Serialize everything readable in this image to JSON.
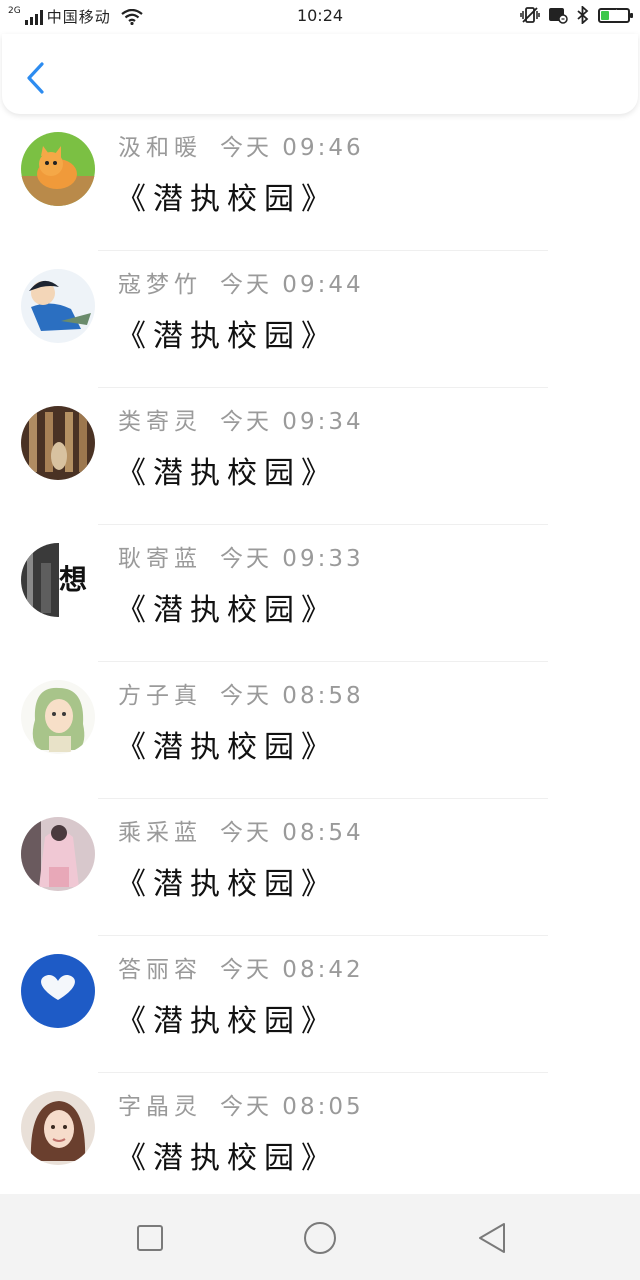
{
  "status_bar": {
    "network_gen": "2G",
    "carrier": "中国移动",
    "time": "10:24",
    "battery_color": "#3cc84a",
    "battery_level": 0.3,
    "icons": [
      "signal-icon",
      "wifi-icon",
      "vibrate-icon",
      "nfc-icon",
      "bluetooth-icon",
      "battery-icon"
    ]
  },
  "header": {
    "back_icon": "chevron-left-icon",
    "accent": "#2d8cf0"
  },
  "messages": [
    {
      "name": "汲和暖",
      "time": "今天 09:46",
      "title": "《潜执校园》",
      "avatar": "kitten"
    },
    {
      "name": "寇梦竹",
      "time": "今天 09:44",
      "title": "《潜执校园》",
      "avatar": "anime-boy"
    },
    {
      "name": "类寄灵",
      "time": "今天 09:34",
      "title": "《潜执校园》",
      "avatar": "sepia-hall"
    },
    {
      "name": "耿寄蓝",
      "time": "今天 09:33",
      "title": "《潜执校园》",
      "avatar": "bw-text",
      "avatar_text": "想"
    },
    {
      "name": "方子真",
      "time": "今天 08:58",
      "title": "《潜执校园》",
      "avatar": "green-hair-girl"
    },
    {
      "name": "乘采蓝",
      "time": "今天 08:54",
      "title": "《潜执校园》",
      "avatar": "pink-girl"
    },
    {
      "name": "答丽容",
      "time": "今天 08:42",
      "title": "《潜执校园》",
      "avatar": "blue-sky-heart"
    },
    {
      "name": "字晶灵",
      "time": "今天 08:05",
      "title": "《潜执校园》",
      "avatar": "girl-photo"
    }
  ],
  "nav": {
    "recent_icon": "square-icon",
    "home_icon": "circle-icon",
    "back_icon": "triangle-back-icon"
  }
}
